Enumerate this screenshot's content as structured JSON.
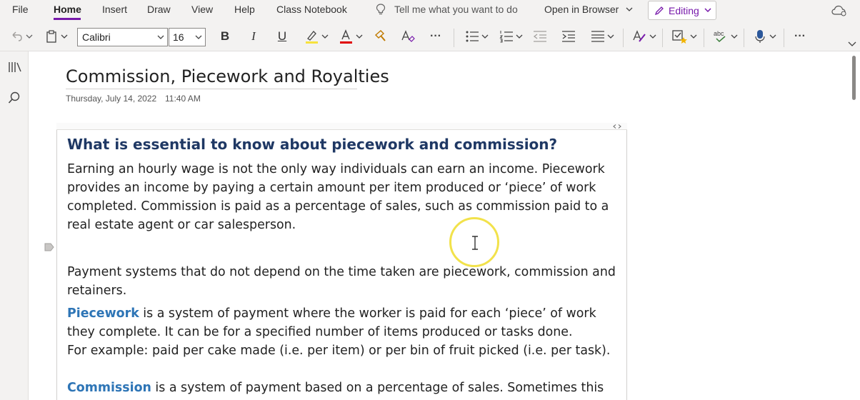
{
  "menu": {
    "file": "File",
    "home": "Home",
    "insert": "Insert",
    "draw": "Draw",
    "view": "View",
    "help": "Help",
    "class_notebook": "Class Notebook",
    "tell_me": "Tell me what you want to do",
    "open_in_browser": "Open in Browser",
    "editing": "Editing"
  },
  "ribbon": {
    "font_name": "Calibri",
    "font_size": "16",
    "bold": "B",
    "italic": "I",
    "underline": "U",
    "more": "···",
    "highlight_color": "#f7e23e",
    "font_color": "#e00000"
  },
  "page": {
    "title": "Commission, Piecework and Royalties",
    "date": "Thursday, July 14, 2022",
    "time": "11:40 AM"
  },
  "content": {
    "heading": "What is essential to know about piecework and commission?",
    "p1": "Earning an hourly wage is not the only way individuals can earn an income. Piecework provides an income by paying a certain amount per item produced or ‘piece’ of work completed. Commission is paid as a percentage of sales, such as commission paid to a real estate agent or car salesperson.",
    "p2": "Payment systems that do not depend on the time taken are piecework, commission and retainers.",
    "piecework_kw": "Piecework",
    "p3_rest": " is a system of payment where the worker is paid for each ‘piece’ of work they complete. It can be for a specified number of items produced or tasks done.",
    "p3_example": "For example: paid per cake made (i.e. per item) or per bin of fruit picked (i.e. per task).",
    "commission_kw": "Commission",
    "p4_rest": " is a system of payment based on a percentage of sales. Sometimes this type"
  },
  "colors": {
    "accent": "#7719aa",
    "heading": "#1f3864",
    "keyword": "#2e75b6"
  }
}
